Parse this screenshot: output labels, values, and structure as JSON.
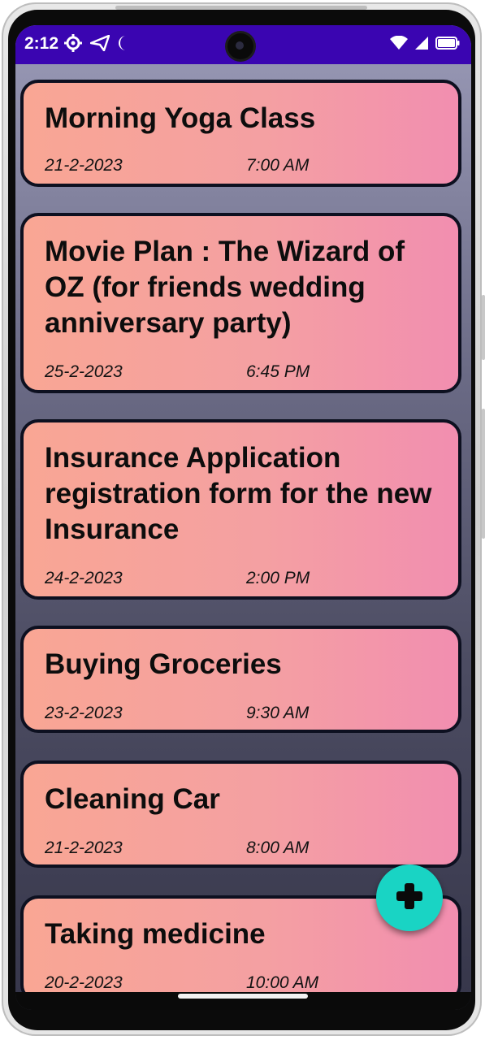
{
  "status_bar": {
    "time": "2:12",
    "bg_color": "#3a05b1",
    "icons_left": [
      "settings-gear-icon",
      "paper-plane-icon",
      "moon-icon"
    ],
    "icons_right": [
      "wifi-icon",
      "cellular-signal-icon",
      "battery-icon"
    ]
  },
  "tasks": [
    {
      "title": "Morning Yoga Class",
      "date": "21-2-2023",
      "time": "7:00 AM"
    },
    {
      "title": "Movie Plan : The Wizard of OZ (for friends wedding anniversary party)",
      "date": "25-2-2023",
      "time": "6:45 PM"
    },
    {
      "title": "Insurance Application registration form for the new Insurance",
      "date": "24-2-2023",
      "time": "2:00 PM"
    },
    {
      "title": "Buying Groceries",
      "date": "23-2-2023",
      "time": "9:30 AM"
    },
    {
      "title": "Cleaning Car",
      "date": "21-2-2023",
      "time": "8:00 AM"
    },
    {
      "title": "Taking medicine",
      "date": "20-2-2023",
      "time": "10:00 AM"
    }
  ],
  "fab": {
    "icon": "plus-icon",
    "color": "#19d4c4"
  },
  "colors": {
    "card_gradient_start": "#f9a694",
    "card_gradient_end": "#f28eb0",
    "card_border": "#0d1020"
  }
}
